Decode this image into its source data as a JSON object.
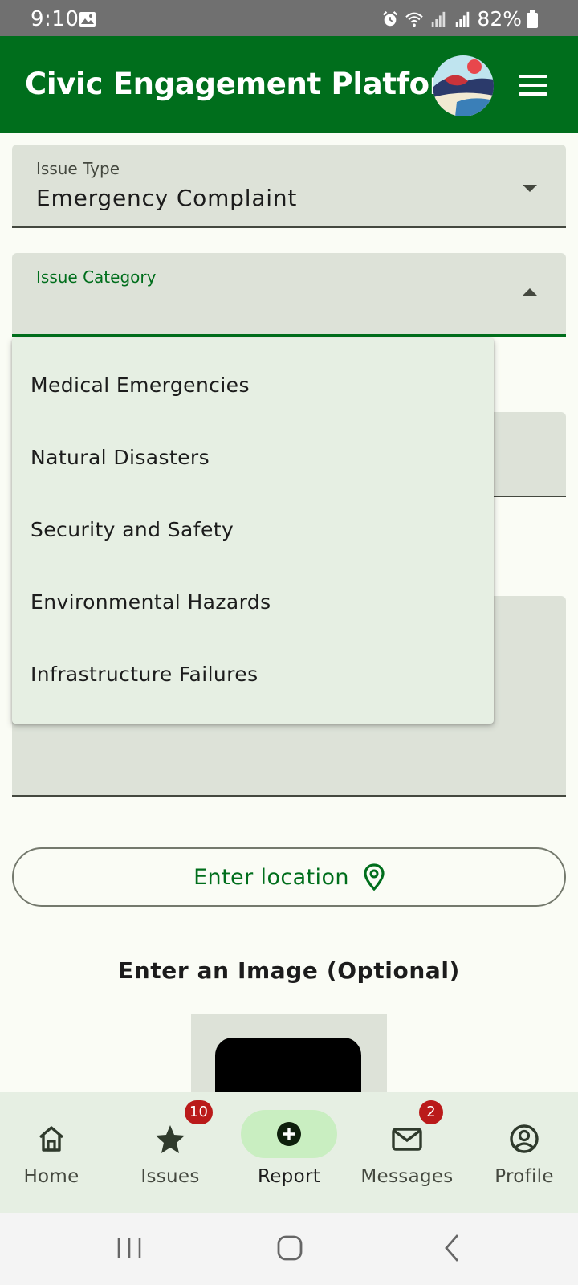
{
  "status_bar": {
    "time": "9:10",
    "battery": "82%",
    "icons": [
      "gallery-icon",
      "alarm-icon",
      "wifi-icon",
      "signal-icon",
      "signal-icon",
      "battery-icon"
    ]
  },
  "app_bar": {
    "title": "Civic Engagement Platform",
    "avatar_icon": "avatar-image",
    "menu_icon": "hamburger-menu-icon",
    "background": "#006e1c"
  },
  "form": {
    "issue_type": {
      "label": "Issue Type",
      "value": "Emergency Complaint"
    },
    "issue_category": {
      "label": "Issue Category",
      "value": "",
      "expanded": true,
      "options": [
        "Medical Emergencies",
        "Natural Disasters",
        "Security and Safety",
        "Environmental Hazards",
        "Infrastructure Failures"
      ]
    },
    "location_button": {
      "label": "Enter location",
      "icon": "location-pin-icon"
    },
    "image_section": {
      "heading": "Enter an Image (Optional)"
    }
  },
  "bottom_nav": {
    "items": [
      {
        "label": "Home",
        "icon": "home-icon",
        "badge": ""
      },
      {
        "label": "Issues",
        "icon": "star-icon",
        "badge": "10"
      },
      {
        "label": "Report",
        "icon": "add-circle-icon",
        "badge": "",
        "active": true
      },
      {
        "label": "Messages",
        "icon": "mail-icon",
        "badge": "2"
      },
      {
        "label": "Profile",
        "icon": "account-circle-icon",
        "badge": ""
      }
    ]
  },
  "colors": {
    "primary": "#006e1c",
    "surface": "#fafcf5",
    "field_fill": "#dde2d8",
    "menu_fill": "#e6efe3",
    "badge": "#ba1a1a",
    "active_pill": "#c9eec1"
  }
}
